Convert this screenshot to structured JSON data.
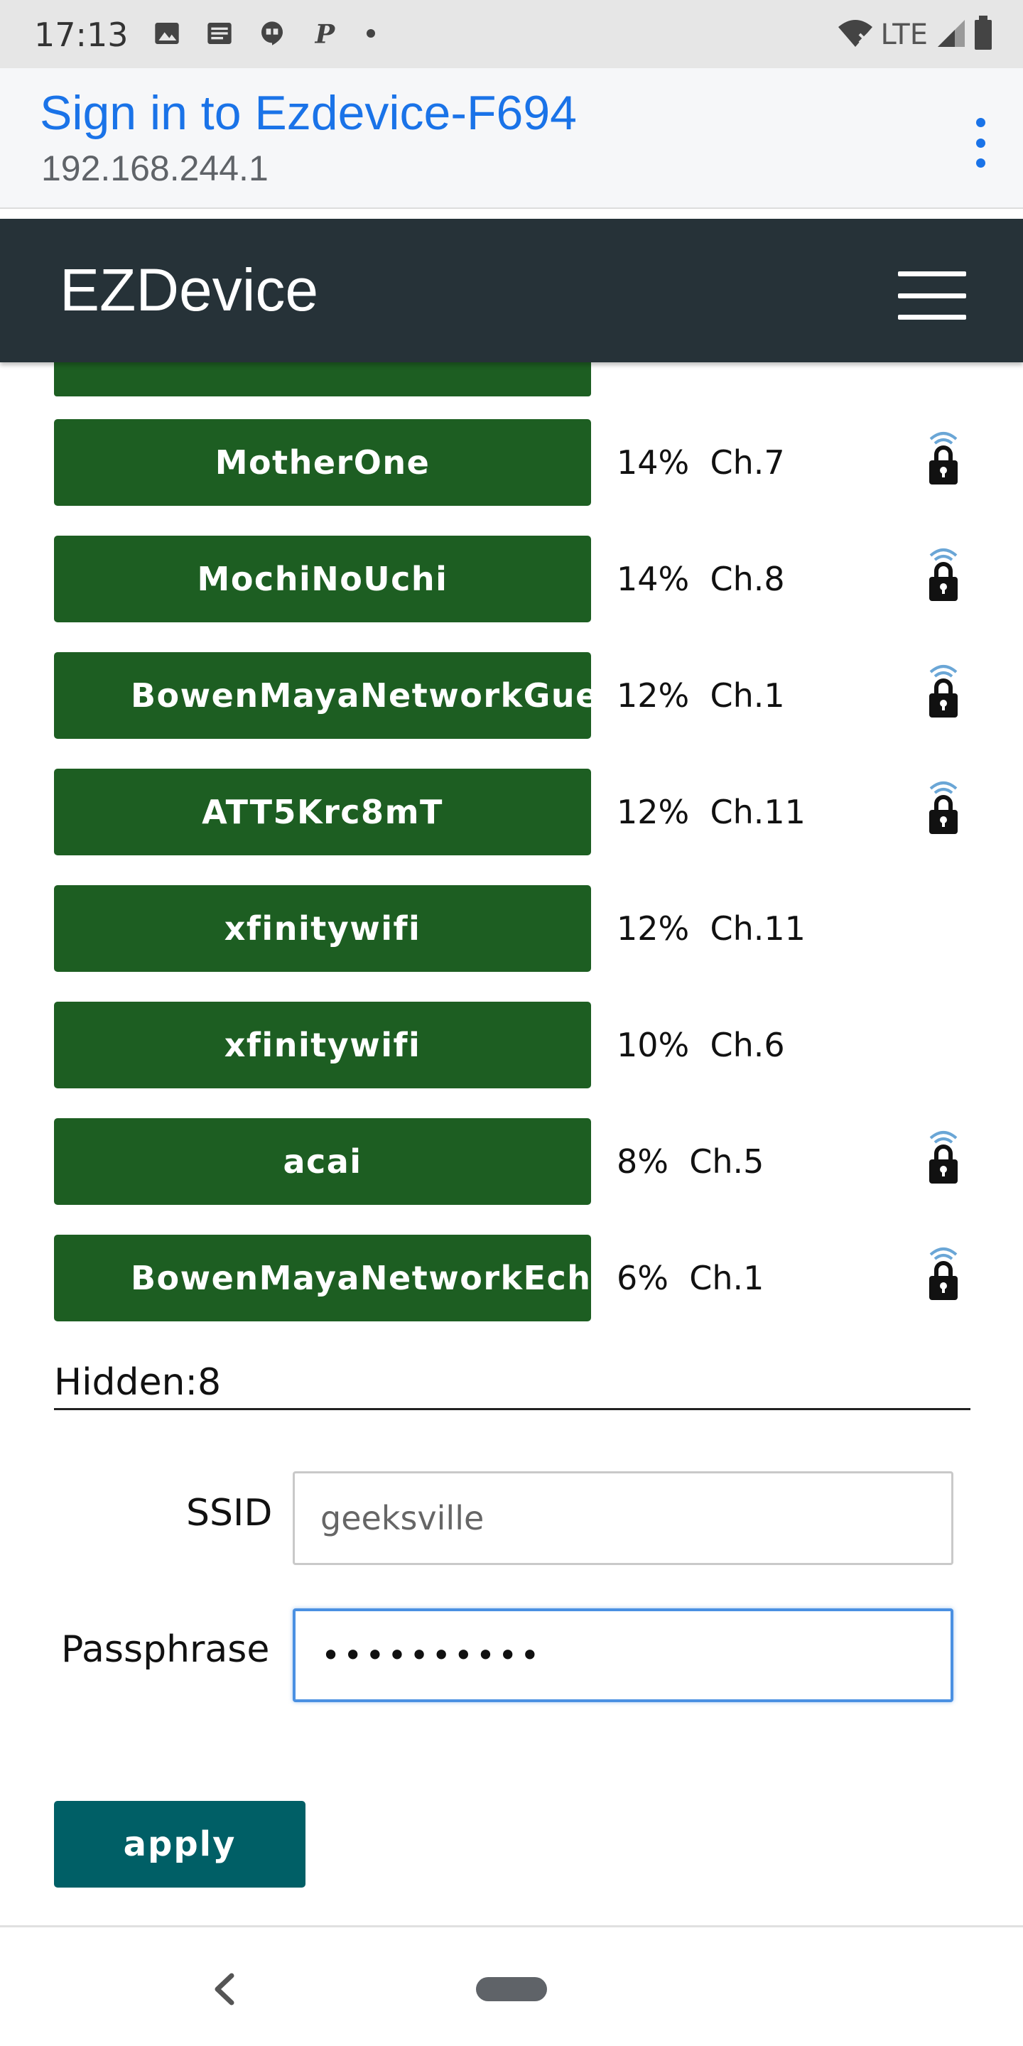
{
  "status_bar": {
    "time": "17:13",
    "network": "LTE",
    "icons": [
      "image-icon",
      "news-icon",
      "hangouts-icon",
      "pinterest-icon",
      "dot-icon",
      "wifi-off-icon",
      "signal-icon",
      "battery-icon"
    ]
  },
  "portal": {
    "title": "Sign in to Ezdevice-F694",
    "url": "192.168.244.1"
  },
  "app": {
    "brand": "EZDevice"
  },
  "networks": [
    {
      "ssid": "MotherOne",
      "signal": "14%",
      "channel": "Ch.7",
      "locked": true
    },
    {
      "ssid": "MochiNoUchi",
      "signal": "14%",
      "channel": "Ch.8",
      "locked": true
    },
    {
      "ssid": "BowenMayaNetworkGuest",
      "signal": "12%",
      "channel": "Ch.1",
      "locked": true
    },
    {
      "ssid": "ATT5Krc8mT",
      "signal": "12%",
      "channel": "Ch.11",
      "locked": true
    },
    {
      "ssid": "xfinitywifi",
      "signal": "12%",
      "channel": "Ch.11",
      "locked": false
    },
    {
      "ssid": "xfinitywifi",
      "signal": "10%",
      "channel": "Ch.6",
      "locked": false
    },
    {
      "ssid": "acai",
      "signal": "8%",
      "channel": "Ch.5",
      "locked": true
    },
    {
      "ssid": "BowenMayaNetworkEcho",
      "signal": "6%",
      "channel": "Ch.1",
      "locked": true
    }
  ],
  "hidden_label": "Hidden:8",
  "form": {
    "ssid_label": "SSID",
    "ssid_placeholder": "geeksville",
    "passphrase_label": "Passphrase",
    "passphrase_value": "••••••••••",
    "apply_label": "apply"
  },
  "colors": {
    "network_button": "#1d5e22",
    "apply_button": "#005f66",
    "navbar": "#263238",
    "portal_title": "#1a73e8"
  }
}
